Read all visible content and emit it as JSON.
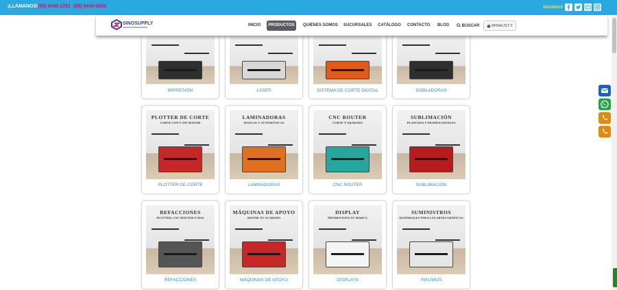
{
  "topbar": {
    "call_label": "¡LLÁMANOS!",
    "phone_1": "(55) 5440-1751",
    "phone_2": "(55) 5440-0933",
    "follow_label": "SÍGUENOS",
    "social_icons": [
      "facebook-icon",
      "twitter-icon",
      "youtube-icon",
      "instagram-icon"
    ]
  },
  "header": {
    "logo_text": "SINOSUPPLY",
    "nav": [
      "INICIO",
      "PRODUCTOS",
      "QUIÉNES SOMOS",
      "SUCURSALES",
      "CATÁLOGO",
      "CONTACTO",
      "BLOG",
      "BUSCAR"
    ],
    "active_nav": "PRODUCTOS",
    "wishlist_label": "WISHLIST 0"
  },
  "products": [
    {
      "label": "IMPRESIÓN",
      "heading": "",
      "subheading": ""
    },
    {
      "label": "LÁSER",
      "heading": "",
      "subheading": ""
    },
    {
      "label": "SISTEMA DE CORTE DIGITAL",
      "heading": "",
      "subheading": ""
    },
    {
      "label": "DOBLADORAS",
      "heading": "",
      "subheading": ""
    },
    {
      "label": "PLOTTER DE CORTE",
      "heading": "PLOTTER DE CORTE",
      "subheading": "CORTE CON Y SIN SENSOR"
    },
    {
      "label": "LAMINADORAS",
      "heading": "LAMINADORAS",
      "subheading": "MANUAL Y AUTOMÁTICAS"
    },
    {
      "label": "CNC ROUTER",
      "heading": "CNC ROUTER",
      "subheading": "CORTE Y GRABADO"
    },
    {
      "label": "SUBLIMACIÓN",
      "heading": "SUBLIMACIÓN",
      "subheading": "PLANCHAS Y PROMOCIONALES"
    },
    {
      "label": "REFACCIONES",
      "heading": "REFACCIONES",
      "subheading": "PLOTTER, CNC ROUTER Y MAS"
    },
    {
      "label": "MÁQUINAS DE APOYO",
      "heading": "MÁQUINAS DE APOYO",
      "subheading": "DEFINE TU ACABADO"
    },
    {
      "label": "DISPLAYS",
      "heading": "DISPLAY",
      "subheading": "PROMOCIONA TU MARCA"
    },
    {
      "label": "INSUMOS",
      "heading": "SUMINISTROS",
      "subheading": "MATERIALES PARA LAS ARTES GRÁFICAS"
    }
  ],
  "floating_buttons": [
    {
      "icon": "email-icon",
      "color": "#1e5fbf"
    },
    {
      "icon": "whatsapp-icon",
      "color": "#25a244"
    },
    {
      "icon": "phone-icon",
      "color": "#e08a14"
    },
    {
      "icon": "phone-icon",
      "color": "#e08a14"
    }
  ],
  "colors": {
    "topbar": "#2aa8e0",
    "accent": "#1e98d7",
    "phone_text": "#c2185b",
    "active_nav": "#5a5a62"
  }
}
